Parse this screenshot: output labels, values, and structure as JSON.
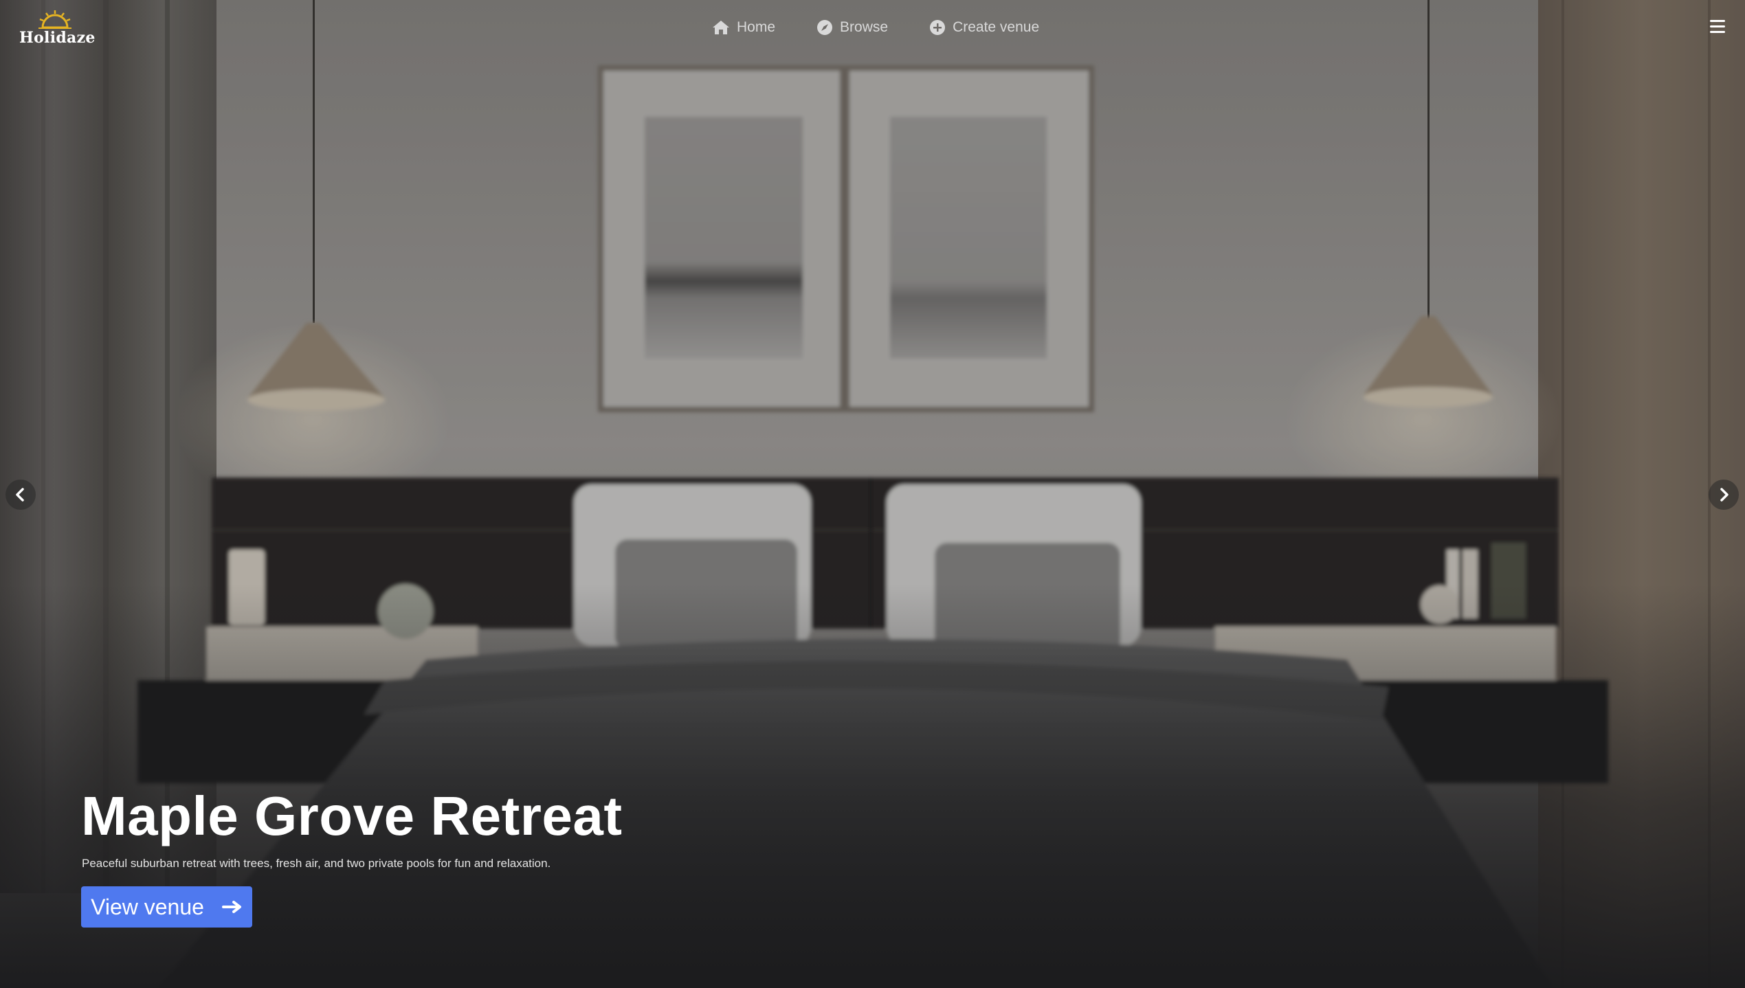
{
  "brand": {
    "name": "Holidaze"
  },
  "nav": {
    "items": [
      {
        "label": "Home",
        "icon": "home-icon"
      },
      {
        "label": "Browse",
        "icon": "compass-icon"
      },
      {
        "label": "Create venue",
        "icon": "plus-circle-icon"
      }
    ]
  },
  "header": {
    "menu_icon": "hamburger-menu-icon"
  },
  "carousel": {
    "prev_icon": "chevron-left-icon",
    "next_icon": "chevron-right-icon"
  },
  "hero": {
    "title": "Maple Grove Retreat",
    "description": "Peaceful suburban retreat with trees, fresh air, and two private pools for fun and relaxation.",
    "cta_label": "View venue",
    "cta_icon": "arrow-right-icon"
  },
  "colors": {
    "accent": "#4f79ef",
    "logo_gold": "#e6b422",
    "overlay_dark": "#1b1b1d"
  }
}
